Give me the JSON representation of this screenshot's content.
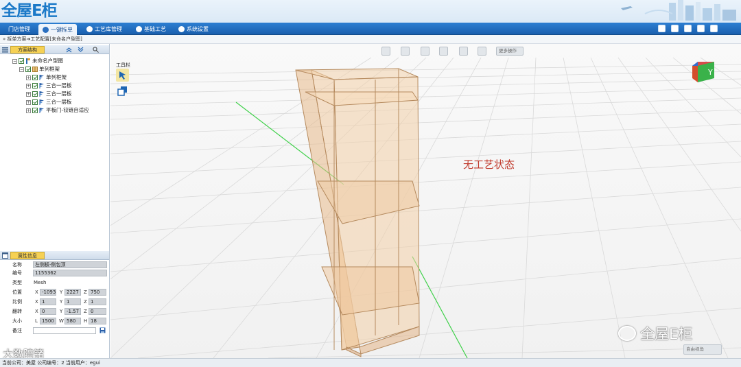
{
  "app": {
    "logo_text": "全屋E柜"
  },
  "nav": {
    "items": [
      {
        "label": "门店管理",
        "active": false
      },
      {
        "label": "一键拆单",
        "active": true
      },
      {
        "label": "工艺库管理",
        "active": false
      },
      {
        "label": "基础工艺",
        "active": false
      },
      {
        "label": "系统设置",
        "active": false
      }
    ]
  },
  "breadcrumb": "拆单方案➜工艺配置[未命名户型图]",
  "scheme_panel": {
    "title": "方案结构",
    "tree": [
      {
        "label": "未命名户型图",
        "level": 0,
        "toggle": "−"
      },
      {
        "label": "单列框架",
        "level": 1,
        "toggle": "−"
      },
      {
        "label": "单列框架",
        "level": 2,
        "toggle": "+"
      },
      {
        "label": "三合一层板",
        "level": 2,
        "toggle": "+"
      },
      {
        "label": "三合一层板",
        "level": 2,
        "toggle": "+"
      },
      {
        "label": "三合一层板",
        "level": 2,
        "toggle": "+"
      },
      {
        "label": "平板门-铰链自适应",
        "level": 2,
        "toggle": "+"
      }
    ]
  },
  "properties": {
    "title": "属性信息",
    "name_label": "名称",
    "name_value": "左侧板-侧包顶",
    "id_label": "编号",
    "id_value": "1155362",
    "type_label": "类型",
    "type_value": "Mesh",
    "position_label": "位置",
    "position": {
      "x": "-1093",
      "y": "2227",
      "z": "750"
    },
    "scale_label": "比例",
    "scale": {
      "x": "1",
      "y": "1",
      "z": "1"
    },
    "rotation_label": "翻转",
    "rotation": {
      "x": "0",
      "y": "-1.57",
      "z": "0"
    },
    "size_label": "大小",
    "size": {
      "l": "1500",
      "w": "580",
      "h": "18"
    },
    "note_label": "备注",
    "note_value": ""
  },
  "viewport": {
    "toolbox_label": "工具栏",
    "more_ops": "更多操作",
    "status_text": "无工艺状态",
    "view_select": "自由视角",
    "cube_label": "Y"
  },
  "watermarks": {
    "brand": "全屋E柜",
    "bottom_left": "大数陪锗"
  },
  "statusbar": "当前公司：美屋   公司编号：2   当前用户：egui"
}
